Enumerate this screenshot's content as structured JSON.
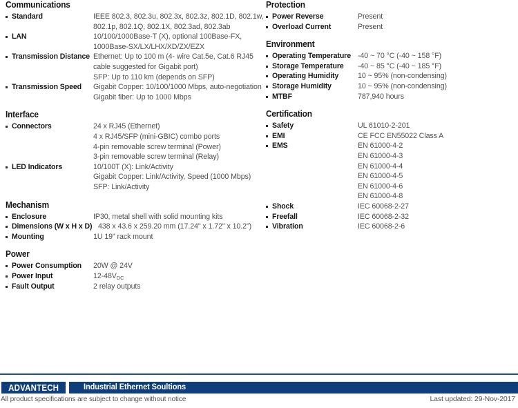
{
  "columns": {
    "left": [
      {
        "title": "Communications",
        "rows": [
          {
            "label": "Standard",
            "values": [
              "IEEE 802.3, 802.3u, 802.3x, 802.3z, 802.1D, 802.1w,",
              "802.1p, 802.1Q, 802.1X, 802.3ad, 802.3ab"
            ]
          },
          {
            "label": "LAN",
            "values": [
              "10/100/1000Base-T (X), optional 100Base-FX,",
              "1000Base-SX/LX/LHX/XD/ZX/EZX"
            ]
          },
          {
            "label": "Transmission Distance",
            "values": [
              "Ethernet: Up to 100 m (4- wire Cat.5e, Cat.6 RJ45",
              "cable suggested for Gigabit port)",
              "SFP: Up to 110 km (depends on SFP)"
            ]
          },
          {
            "label": "Transmission Speed",
            "values": [
              "Gigabit Copper: 10/100/1000 Mbps, auto-negotiation",
              "Gigabit fiber: Up to 1000 Mbps"
            ]
          }
        ]
      },
      {
        "title": "Interface",
        "rows": [
          {
            "label": "Connectors",
            "values": [
              "24 x RJ45 (Ethernet)",
              "4 x RJ45/SFP (mini-GBIC) combo ports",
              "4-pin removable screw terminal (Power)",
              "3-pin removable screw terminal (Relay)"
            ]
          },
          {
            "label": "LED Indicators",
            "values": [
              "10/100T (X): Link/Activity",
              "Gigabit Copper: Link/Activity, Speed (1000 Mbps)",
              "SFP: Link/Activity"
            ]
          }
        ]
      },
      {
        "title": "Mechanism",
        "rows": [
          {
            "label": "Enclosure",
            "values": [
              "IP30, metal shell with solid mounting kits"
            ]
          },
          {
            "label": "Dimensions (W x H x D)",
            "wide": true,
            "values": [
              "438 x 43.6 x 259.20 mm (17.24\" x 1.72\" x 10.2\")"
            ]
          },
          {
            "label": "Mounting",
            "values": [
              "1U 19\" rack mount"
            ]
          }
        ]
      },
      {
        "title": "Power",
        "rows": [
          {
            "label": "Power Consumption",
            "values": [
              "20W @ 24V"
            ]
          },
          {
            "label": "Power Input",
            "values": [
              "12-48V"
            ],
            "subscript": "DC"
          },
          {
            "label": "Fault Output",
            "values": [
              "2 relay outputs"
            ]
          }
        ]
      }
    ],
    "right": [
      {
        "title": "Protection",
        "rows": [
          {
            "label": "Power Reverse",
            "values": [
              "Present"
            ]
          },
          {
            "label": "Overload Current",
            "values": [
              "Present"
            ]
          }
        ]
      },
      {
        "title": "Environment",
        "rows": [
          {
            "label": "Operating Temperature",
            "values": [
              "-40 ~ 70 °C (-40 ~ 158 °F)"
            ]
          },
          {
            "label": "Storage Temperature",
            "values": [
              "-40 ~ 85 °C (-40 ~ 185 °F)"
            ]
          },
          {
            "label": "Operating Humidity",
            "values": [
              "10 ~ 95% (non-condensing)"
            ]
          },
          {
            "label": "Storage Humidity",
            "values": [
              "10 ~ 95% (non-condensing)"
            ]
          },
          {
            "label": "MTBF",
            "values": [
              "787,940 hours"
            ]
          }
        ]
      },
      {
        "title": "Certification",
        "rows": [
          {
            "label": "Safety",
            "values": [
              "UL 61010-2-201"
            ]
          },
          {
            "label": "EMI",
            "values": [
              "CE FCC EN55022 Class A"
            ]
          },
          {
            "label": "EMS",
            "values": [
              "EN 61000-4-2",
              "EN 61000-4-3",
              "EN 61000-4-4",
              "EN 61000-4-5",
              "EN 61000-4-6",
              "EN 61000-4-8"
            ]
          },
          {
            "label": "Shock",
            "values": [
              "IEC 60068-2-27"
            ]
          },
          {
            "label": "Freefall",
            "values": [
              "IEC 60068-2-32"
            ]
          },
          {
            "label": "Vibration",
            "values": [
              "IEC 60068-2-6"
            ]
          }
        ]
      }
    ]
  },
  "footer": {
    "logo_text": "ADVANTECH",
    "tagline": "Industrial Ethernet Soultions",
    "disclaimer": "All product specifications are subject to change without notice",
    "last_updated": "Last updated: 29-Nov-2017"
  },
  "colors": {
    "brand_blue": "#0f3f7a",
    "rule_blue": "#1d4f8c",
    "label_text": "#171717",
    "value_text": "#4f4f4f"
  }
}
